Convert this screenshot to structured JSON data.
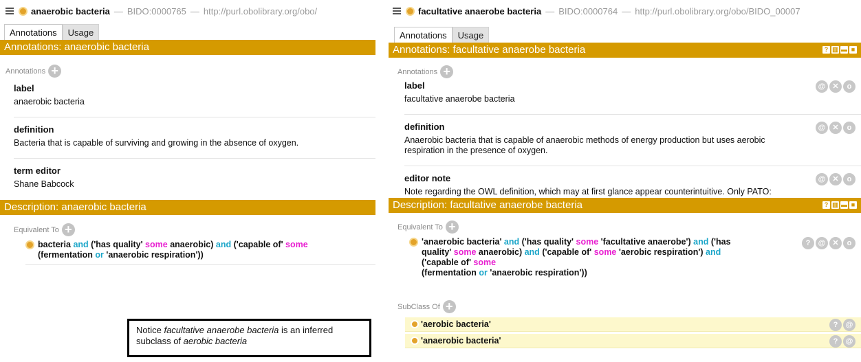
{
  "left": {
    "entity_name": "anaerobic bacteria",
    "entity_id": "BIDO:0000765",
    "entity_iri": "http://purl.obolibrary.org/obo/",
    "tabs": [
      "Annotations",
      "Usage"
    ],
    "annotations_header": "Annotations: anaerobic bacteria",
    "annotations_frame_label": "Annotations",
    "annotations": [
      {
        "label": "label",
        "value": "anaerobic bacteria"
      },
      {
        "label": "definition",
        "value": "Bacteria that is capable of surviving and growing in the absence of oxygen."
      },
      {
        "label": "term editor",
        "value": "Shane Babcock"
      }
    ],
    "description_header": "Description: anaerobic bacteria",
    "equivalent_frame_label": "Equivalent To",
    "equivalent": {
      "line1": [
        "bacteria",
        "and",
        "('has quality'",
        "some",
        "anaerobic)",
        "and",
        "('capable of'",
        "some"
      ],
      "line2": [
        "(fermentation",
        "or",
        "'anaerobic respiration'))"
      ]
    }
  },
  "right": {
    "entity_name": "facultative anaerobe bacteria",
    "entity_id": "BIDO:0000764",
    "entity_iri": "http://purl.obolibrary.org/obo/BIDO_00007",
    "tabs": [
      "Annotations",
      "Usage"
    ],
    "annotations_header": "Annotations: facultative anaerobe bacteria",
    "annotations_frame_label": "Annotations",
    "annotations": [
      {
        "label": "label",
        "value": "facultative anaerobe bacteria"
      },
      {
        "label": "definition",
        "value": "Anaerobic bacteria that is capable of anaerobic methods of energy production but uses aerobic respiration in the presence of oxygen."
      },
      {
        "label": "editor note",
        "value": "Note regarding the OWL definition, which may at first glance appear counterintuitive. Only PATO: anaerobic, and not PATO:aerobic, is included because although facultative anaerobe baceteria are"
      }
    ],
    "description_header": "Description: facultative anaerobe bacteria",
    "equivalent_frame_label": "Equivalent To",
    "equivalent": {
      "line1": [
        "'anaerobic bacteria'",
        "and",
        "('has quality'",
        "some",
        "'facultative anaerobe')",
        "and",
        "('has"
      ],
      "line2": [
        "quality'",
        "some",
        "anaerobic)",
        "and",
        "('capable of'",
        "some",
        "'aerobic respiration')",
        "and"
      ],
      "line3": [
        "('capable of'",
        "some"
      ],
      "line4": [
        "(fermentation",
        "or",
        "'anaerobic respiration'))"
      ]
    },
    "subclass_frame_label": "SubClass Of",
    "subclasses": [
      "'aerobic bacteria'",
      "'anaerobic bacteria'"
    ]
  },
  "notice": {
    "prefix": "Notice ",
    "italic1": "facultative anaerobe bacteria",
    "middle": " is an inferred subclass of ",
    "italic2": "aerobic bacteria"
  },
  "colors": {
    "header_gold": "#d59a00",
    "class_orange": "#e3a32a",
    "keyword_blue": "#1ca6c9",
    "keyword_magenta": "#e81fd0",
    "inferred_yellow": "#fdf8cc"
  },
  "icons": {
    "menu": "hamburger-icon",
    "class": "class-circle-icon",
    "add": "plus-circle-icon",
    "annotate": "at-icon",
    "delete": "x-circle-icon",
    "edit": "o-circle-icon",
    "explain": "question-circle-icon"
  }
}
